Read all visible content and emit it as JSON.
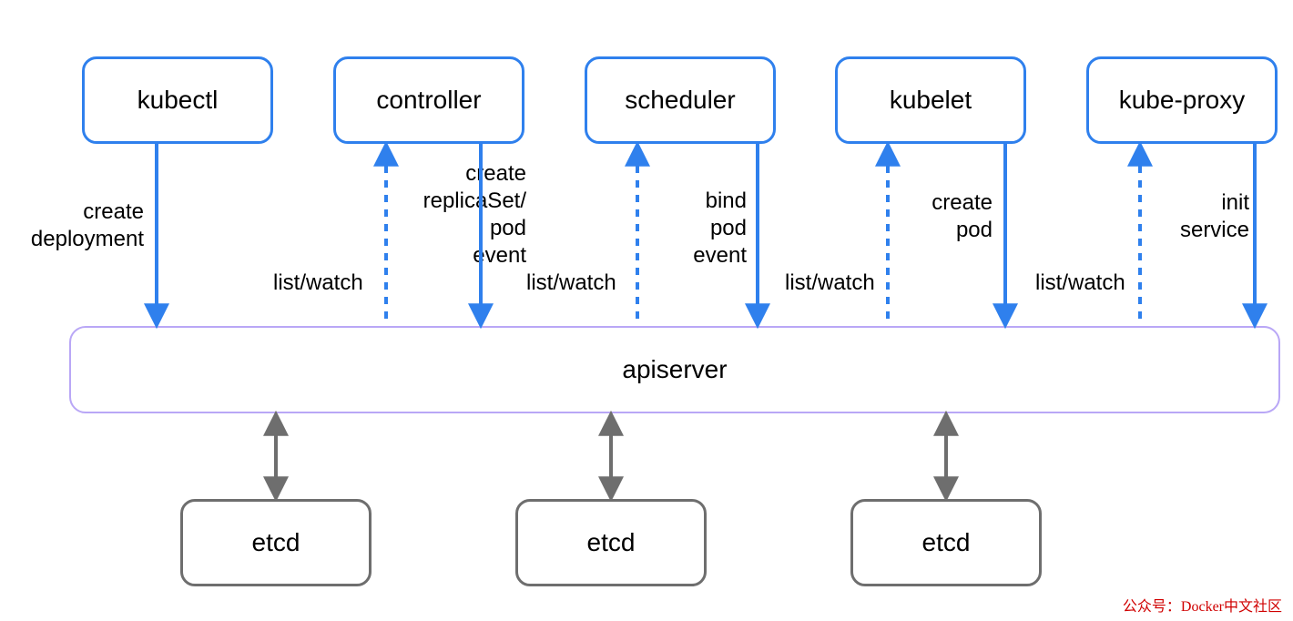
{
  "colors": {
    "blue": "#2F80ED",
    "purple": "#B9A7F6",
    "gray": "#6e6e6e"
  },
  "topBoxes": {
    "kubectl": "kubectl",
    "controller": "controller",
    "scheduler": "scheduler",
    "kubelet": "kubelet",
    "kubeproxy": "kube-proxy"
  },
  "apiserver": "apiserver",
  "etcd": {
    "e1": "etcd",
    "e2": "etcd",
    "e3": "etcd"
  },
  "edges": {
    "kubectl_down": "create\ndeployment",
    "controller_up": "list/watch",
    "controller_down": "create\nreplicaSet/\npod\nevent",
    "scheduler_up": "list/watch",
    "scheduler_down": "bind\npod\nevent",
    "kubelet_up": "list/watch",
    "kubelet_down": "create\npod",
    "kubeproxy_up": "list/watch",
    "kubeproxy_down": "init\nservice"
  },
  "watermark": "公众号：Docker中文社区"
}
